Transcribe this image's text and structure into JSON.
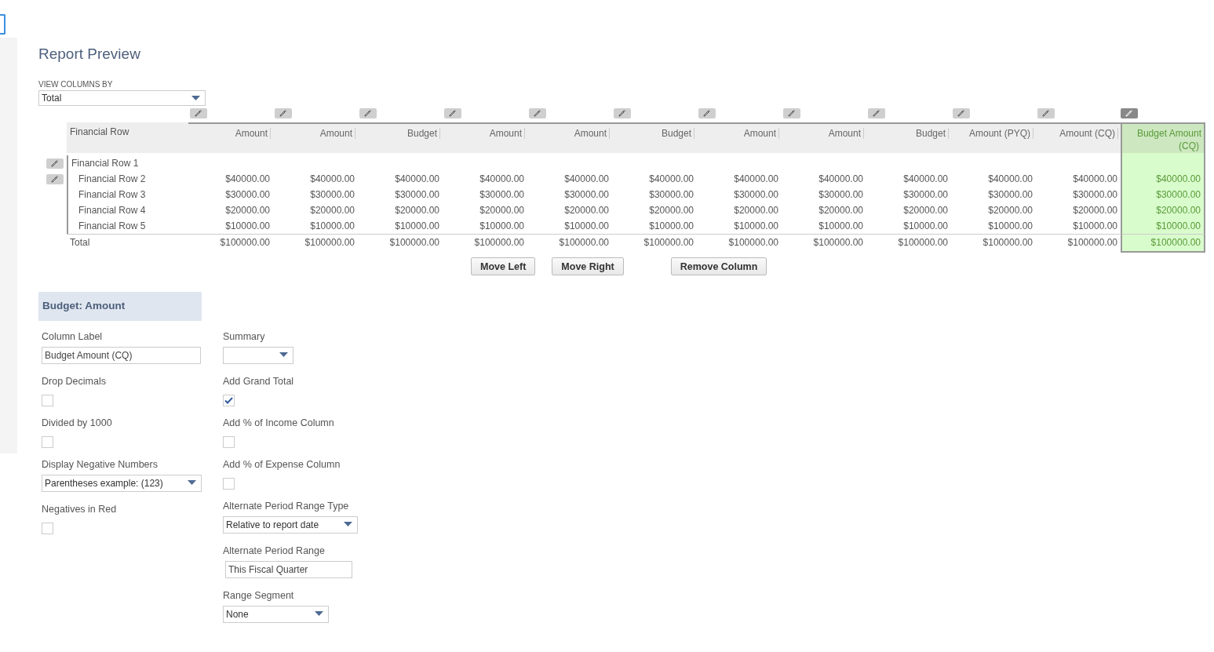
{
  "title": "Report Preview",
  "view_columns_by": {
    "label": "VIEW COLUMNS BY",
    "value": "Total"
  },
  "table": {
    "row_header": "Financial Row",
    "columns": [
      {
        "label": "Amount",
        "selected": false
      },
      {
        "label": "Amount",
        "selected": false
      },
      {
        "label": "Budget",
        "selected": false
      },
      {
        "label": "Amount",
        "selected": false
      },
      {
        "label": "Amount",
        "selected": false
      },
      {
        "label": "Budget",
        "selected": false
      },
      {
        "label": "Amount",
        "selected": false
      },
      {
        "label": "Amount",
        "selected": false
      },
      {
        "label": "Budget",
        "selected": false
      },
      {
        "label": "Amount (PYQ)",
        "selected": false
      },
      {
        "label": "Amount (CQ)",
        "selected": false
      },
      {
        "label": "Budget Amount (CQ)",
        "selected": true
      }
    ],
    "rows": [
      {
        "label": "Financial Row 1",
        "editable": true,
        "children": [
          {
            "label": "Financial Row 2",
            "editable": true,
            "values": [
              "$40000.00",
              "$40000.00",
              "$40000.00",
              "$40000.00",
              "$40000.00",
              "$40000.00",
              "$40000.00",
              "$40000.00",
              "$40000.00",
              "$40000.00",
              "$40000.00",
              "$40000.00"
            ]
          },
          {
            "label": "Financial Row 3",
            "editable": false,
            "values": [
              "$30000.00",
              "$30000.00",
              "$30000.00",
              "$30000.00",
              "$30000.00",
              "$30000.00",
              "$30000.00",
              "$30000.00",
              "$30000.00",
              "$30000.00",
              "$30000.00",
              "$30000.00"
            ]
          },
          {
            "label": "Financial Row 4",
            "editable": false,
            "values": [
              "$20000.00",
              "$20000.00",
              "$20000.00",
              "$20000.00",
              "$20000.00",
              "$20000.00",
              "$20000.00",
              "$20000.00",
              "$20000.00",
              "$20000.00",
              "$20000.00",
              "$20000.00"
            ]
          },
          {
            "label": "Financial Row 5",
            "editable": false,
            "values": [
              "$10000.00",
              "$10000.00",
              "$10000.00",
              "$10000.00",
              "$10000.00",
              "$10000.00",
              "$10000.00",
              "$10000.00",
              "$10000.00",
              "$10000.00",
              "$10000.00",
              "$10000.00"
            ]
          }
        ]
      }
    ],
    "total": {
      "label": "Total",
      "values": [
        "$100000.00",
        "$100000.00",
        "$100000.00",
        "$100000.00",
        "$100000.00",
        "$100000.00",
        "$100000.00",
        "$100000.00",
        "$100000.00",
        "$100000.00",
        "$100000.00",
        "$100000.00"
      ]
    }
  },
  "buttons": [
    "Move Left",
    "Move Right",
    "Remove Column"
  ],
  "section_title": "Budget: Amount",
  "form_left": [
    {
      "kind": "text",
      "label": "Column Label",
      "value": "Budget Amount (CQ)"
    },
    {
      "kind": "checkbox",
      "label": "Drop Decimals",
      "checked": false
    },
    {
      "kind": "checkbox",
      "label": "Divided by 1000",
      "checked": false
    },
    {
      "kind": "select",
      "label": "Display Negative Numbers",
      "value": "Parentheses  example: (123)"
    },
    {
      "kind": "checkbox",
      "label": "Negatives in Red",
      "checked": false
    }
  ],
  "form_right": [
    {
      "kind": "select",
      "label": "Summary"
    },
    {
      "kind": "checkbox",
      "label": "Add Grand Total",
      "checked": true
    },
    {
      "kind": "checkbox",
      "label": "Add % of Income Column",
      "checked": false
    },
    {
      "kind": "checkbox",
      "label": "Add % of Expense Column",
      "checked": false
    },
    {
      "kind": "select",
      "label": "Alternate Period Range Type",
      "value": "Relative to report date"
    },
    {
      "kind": "text",
      "label": "Alternate Period Range",
      "value": "This Fiscal Quarter"
    },
    {
      "kind": "select",
      "label": "Range Segment",
      "value": "None"
    }
  ]
}
